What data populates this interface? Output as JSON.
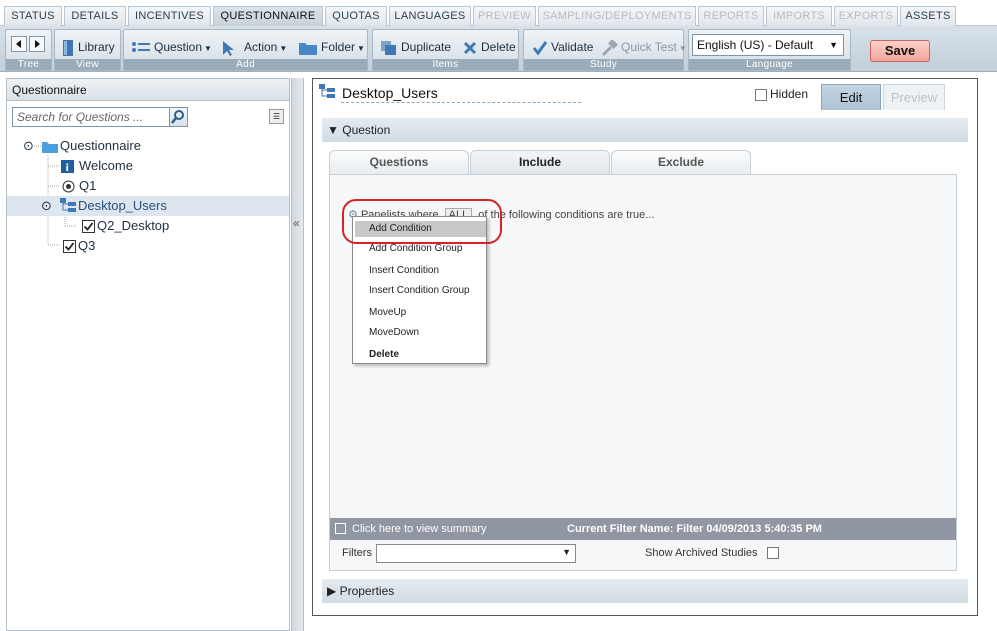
{
  "tabs": [
    {
      "label": "STATUS",
      "state": "normal"
    },
    {
      "label": "DETAILS",
      "state": "normal"
    },
    {
      "label": "INCENTIVES",
      "state": "normal"
    },
    {
      "label": "QUESTIONNAIRE",
      "state": "active"
    },
    {
      "label": "QUOTAS",
      "state": "normal"
    },
    {
      "label": "LANGUAGES",
      "state": "normal"
    },
    {
      "label": "PREVIEW",
      "state": "disabled"
    },
    {
      "label": "SAMPLING/DEPLOYMENTS",
      "state": "disabled"
    },
    {
      "label": "REPORTS",
      "state": "disabled"
    },
    {
      "label": "IMPORTS",
      "state": "disabled"
    },
    {
      "label": "EXPORTS",
      "state": "disabled"
    },
    {
      "label": "ASSETS",
      "state": "normal"
    }
  ],
  "toolbar": {
    "groups": {
      "tree": "Tree",
      "view": "View",
      "add": "Add",
      "items": "Items",
      "study": "Study",
      "language": "Language"
    },
    "library": "Library",
    "question": "Question",
    "action": "Action",
    "folder": "Folder",
    "duplicate": "Duplicate",
    "delete": "Delete",
    "validate": "Validate",
    "quick_test": "Quick Test",
    "language_value": "English (US) - Default",
    "save": "Save"
  },
  "left": {
    "header": "Questionnaire",
    "search_placeholder": "Search for Questions ...",
    "tree": {
      "root": "Questionnaire",
      "welcome": "Welcome",
      "q1": "Q1",
      "folder": "Desktop_Users",
      "q2": "Q2_Desktop",
      "q3": "Q3"
    }
  },
  "right": {
    "title": "Desktop_Users",
    "hidden_label": "Hidden",
    "edit_tab": "Edit",
    "preview_tab": "Preview",
    "question_section": "Question",
    "inner_tabs": {
      "questions": "Questions",
      "include": "Include",
      "exclude": "Exclude"
    },
    "condition_prefix": "Panelists where",
    "condition_all": "ALL",
    "condition_suffix": "of the following conditions are true...",
    "context_menu": {
      "add_condition": "Add Condition",
      "add_condition_group": "Add Condition Group",
      "insert_condition": "Insert Condition",
      "insert_condition_group": "Insert Condition Group",
      "move_up": "MoveUp",
      "move_down": "MoveDown",
      "delete": "Delete"
    },
    "summary_link": "Click here to view summary",
    "current_filter": "Current Filter Name: Filter 04/09/2013 5:40:35 PM",
    "filters_label": "Filters",
    "show_archived": "Show Archived Studies",
    "properties_section": "Properties"
  }
}
